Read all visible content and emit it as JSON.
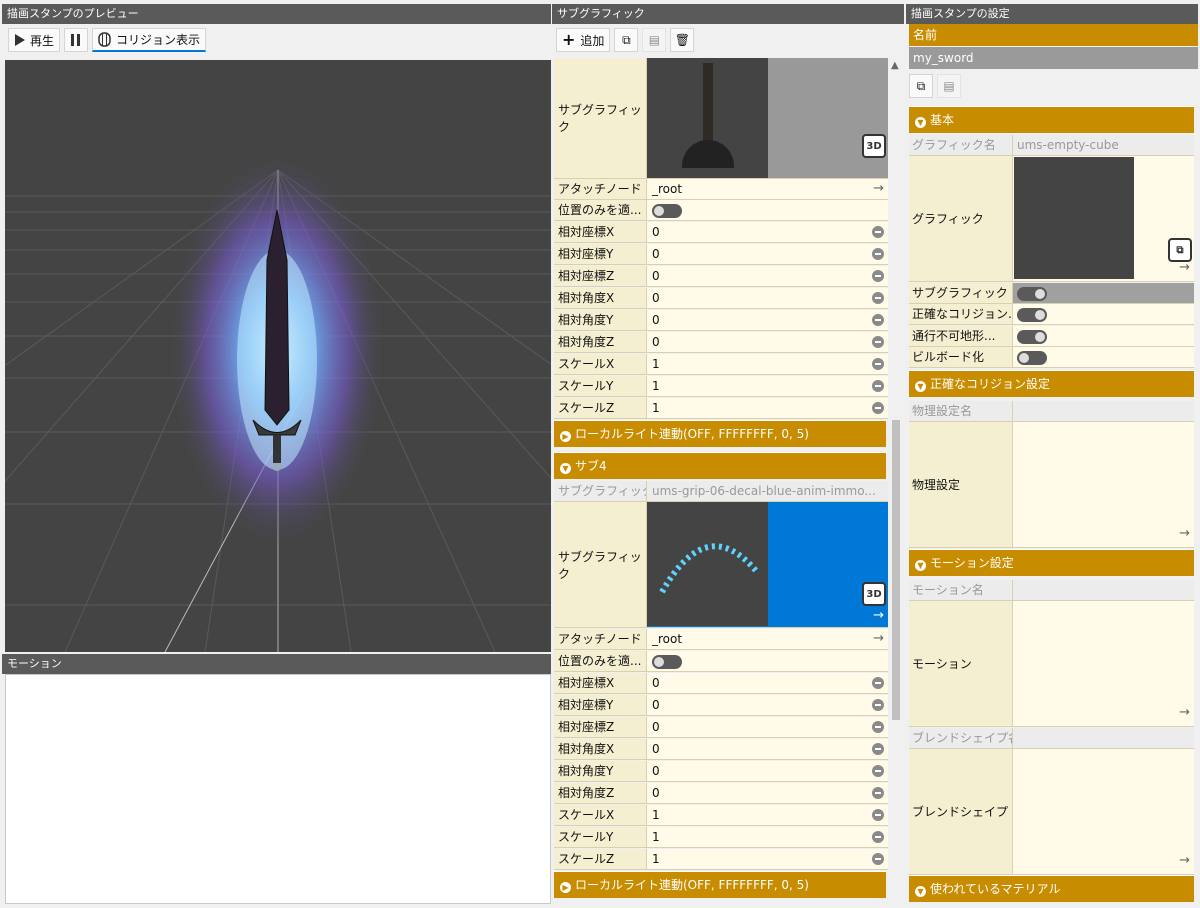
{
  "preview": {
    "title": "描画スタンプのプレビュー",
    "play_label": "再生",
    "collision_label": "コリジョン表示"
  },
  "motion": {
    "title": "モーション"
  },
  "subgraphic": {
    "title": "サブグラフィック",
    "add_label": "追加",
    "row_labels": {
      "subgraphic": "サブグラフィック",
      "attach_node": "アタッチノード",
      "position_only": "位置のみを適...",
      "pos_x": "相対座標X",
      "pos_y": "相対座標Y",
      "pos_z": "相対座標Z",
      "rot_x": "相対角度X",
      "rot_y": "相対角度Y",
      "rot_z": "相対角度Z",
      "scale_x": "スケールX",
      "scale_y": "スケールY",
      "scale_z": "スケールZ",
      "subgraphic_name": "サブグラフィック名"
    },
    "first": {
      "attach_node": "_root",
      "pos_x": "0",
      "pos_y": "0",
      "pos_z": "0",
      "rot_x": "0",
      "rot_y": "0",
      "rot_z": "0",
      "scale_x": "1",
      "scale_y": "1",
      "scale_z": "1",
      "local_light": "ローカルライト連動(OFF, FFFFFFFF, 0, 5)"
    },
    "sub4": {
      "header": "サブ4",
      "name": "ums-grip-06-decal-blue-anim-immo...",
      "attach_node": "_root",
      "pos_x": "0",
      "pos_y": "0",
      "pos_z": "0",
      "rot_x": "0",
      "rot_y": "0",
      "rot_z": "0",
      "scale_x": "1",
      "scale_y": "1",
      "scale_z": "1",
      "local_light": "ローカルライト連動(OFF, FFFFFFFF, 0, 5)"
    },
    "badge_3d": "3D"
  },
  "settings": {
    "title": "描画スタンプの設定",
    "name_label": "名前",
    "name_value": "my_sword",
    "basic_section": "基本",
    "graphic_name_label": "グラフィック名",
    "graphic_name_value": "ums-empty-cube",
    "graphic_label": "グラフィック",
    "subgraphic_label": "サブグラフィック",
    "accurate_collision_label": "正確なコリジョン...",
    "impassable_label": "通行不可地形...",
    "billboard_label": "ビルボード化",
    "accurate_collision_section": "正確なコリジョン設定",
    "physics_name_label": "物理設定名",
    "physics_label": "物理設定",
    "motion_section": "モーション設定",
    "motion_name_label": "モーション名",
    "motion_label": "モーション",
    "blendshape_name_label": "ブレンドシェイプ名",
    "blendshape_label": "ブレンドシェイプ",
    "materials_section": "使われているマテリアル"
  },
  "colors": {
    "accent": "#c88c00",
    "selected_blue": "#0078d7",
    "viewport": "#444444"
  }
}
